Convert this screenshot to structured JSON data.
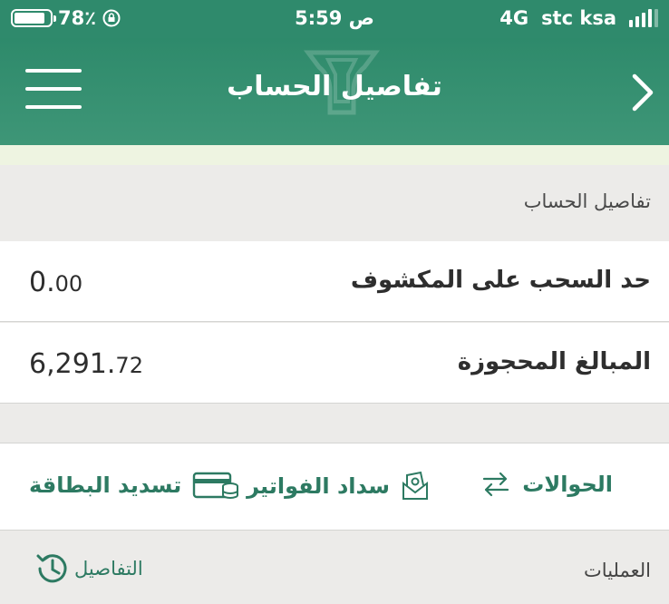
{
  "status_bar": {
    "battery": "78٪",
    "time": "5:59 ص",
    "network": "4G",
    "carrier": "stc ksa"
  },
  "header": {
    "title": "تفاصيل الحساب"
  },
  "section": {
    "title": "تفاصيل الحساب"
  },
  "rows": [
    {
      "label": "حد السحب على المكشوف",
      "value_int": "0.",
      "value_dec": "00"
    },
    {
      "label": "المبالغ المحجوزة",
      "value_int": "6,291.",
      "value_dec": "72"
    }
  ],
  "actions": {
    "transfers": "الحوالات",
    "bills": "سداد الفواتير",
    "card_payment": "تسديد البطاقة"
  },
  "footer": {
    "operations": "العمليات",
    "details": "التفاصيل"
  },
  "colors": {
    "brand_green": "#2f8a6c",
    "action_green": "#2d7a62"
  }
}
